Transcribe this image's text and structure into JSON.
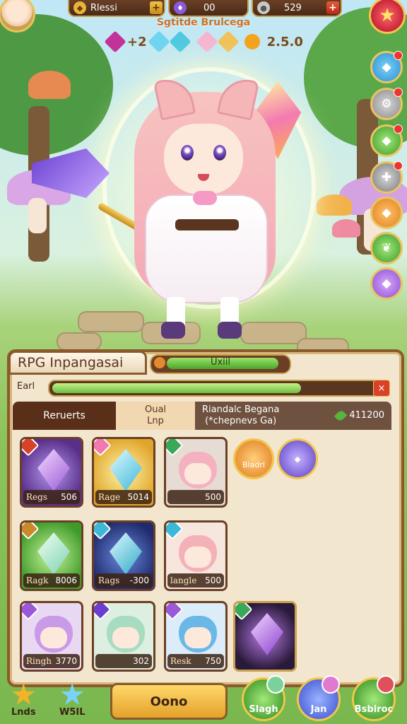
{
  "top_bar": {
    "player_name": "Rlessi",
    "gems_value": "00",
    "coins_value": "529",
    "add_label": "+"
  },
  "header": {
    "subtitle": "Sgtitde Brulcega",
    "stat_left": "+2",
    "stat_right": "2.5.0"
  },
  "panel": {
    "title": "RPG Inpangasai",
    "unit_label": "Uxiil",
    "earn_label": "Earl",
    "earn_fraction": 0.8,
    "close_label": "×",
    "tabs": {
      "tab1": "Reruerts",
      "tab2_line1": "Oual",
      "tab2_line2": "Lnp",
      "tab3_line1": "Riandalc Begana",
      "tab3_line2": "(*chepnevs Ga)",
      "tab3_amount": "411200"
    },
    "cards": [
      {
        "name": "Regs",
        "value": "506"
      },
      {
        "name": "Rage",
        "value": "5014"
      },
      {
        "name": "",
        "value": "500"
      },
      {
        "name": "Ragk",
        "value": "8006"
      },
      {
        "name": "Rags",
        "value": "-300"
      },
      {
        "name": "langle",
        "value": "500"
      },
      {
        "name": "Ringh",
        "value": "3770"
      },
      {
        "name": "",
        "value": "302"
      },
      {
        "name": "Resk",
        "value": "750"
      },
      {
        "name": "",
        "value": ""
      }
    ],
    "orb1_label": "Bladrl"
  },
  "bottom": {
    "item1": "Lnds",
    "item2": "W5IL",
    "main_button": "Oono",
    "round1": "Slagh",
    "round2": "Jan",
    "round3": "Bsbiroc"
  },
  "colors": {
    "frame_brown": "#8a5a2c",
    "gold": "#f2c64b",
    "panel_bg": "#f3e6cf",
    "progress_green": "#6cbe3f"
  }
}
